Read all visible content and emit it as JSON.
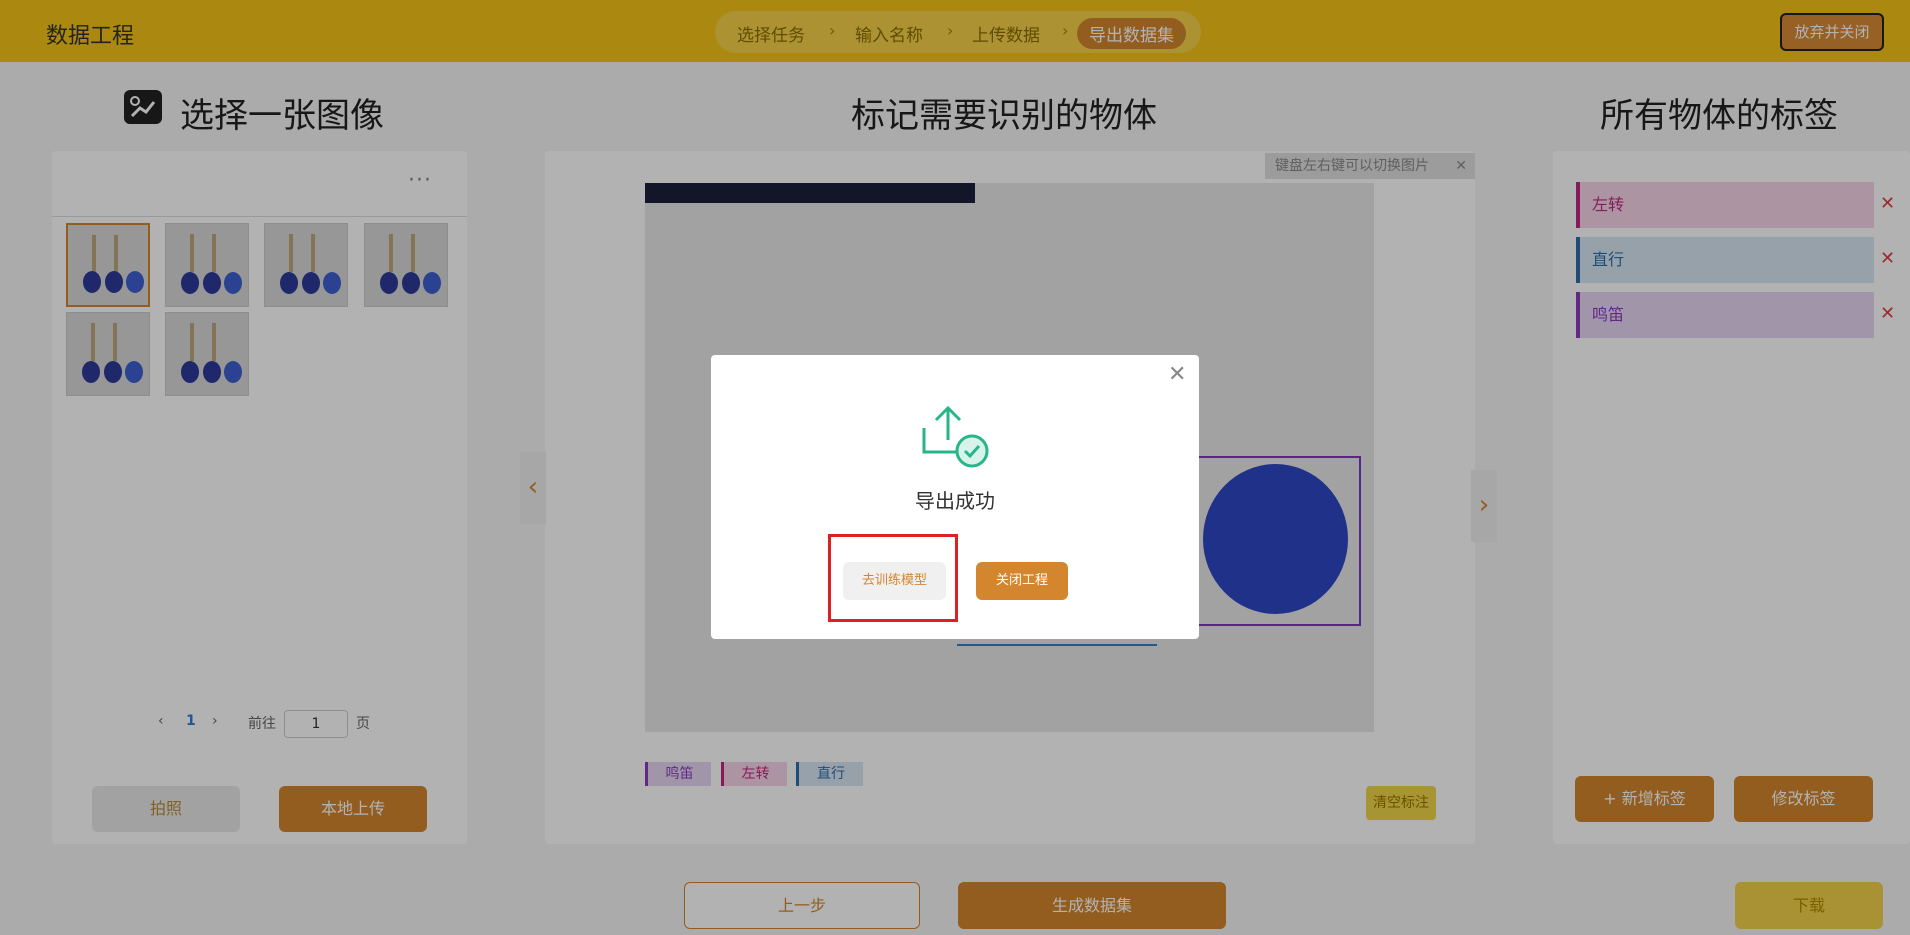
{
  "header": {
    "app_title": "数据工程",
    "steps": [
      "选择任务",
      "输入名称",
      "上传数据",
      "导出数据集"
    ],
    "active_step": 3,
    "close_button": "放弃并关闭"
  },
  "left": {
    "title": "选择一张图像",
    "more": "···",
    "pagination": {
      "prev": "‹",
      "page": "1",
      "next": "›",
      "goto": "前往",
      "input": "1",
      "page_suffix": "页"
    },
    "photo_button": "拍照",
    "upload_button": "本地上传"
  },
  "middle": {
    "title": "标记需要识别的物体",
    "hint": "键盘左右键可以切换图片",
    "hint_close": "✕",
    "prev_arrow": "‹",
    "next_arrow": "›",
    "tags": [
      "鸣笛",
      "左转",
      "直行"
    ],
    "clear_button": "清空标注"
  },
  "right": {
    "title": "所有物体的标签",
    "labels": [
      {
        "name": "左转",
        "color": "#c2267f",
        "bg": "#f7d5e8"
      },
      {
        "name": "直行",
        "color": "#2f6fad",
        "bg": "#d7e7f3"
      },
      {
        "name": "鸣笛",
        "color": "#8b3bbf",
        "bg": "#e7d7f3"
      }
    ],
    "delete_icon": "✕",
    "add_button": "+ 新增标签",
    "edit_button": "修改标签"
  },
  "bottom": {
    "prev_button": "上一步",
    "generate_button": "生成数据集",
    "download_button": "下载"
  },
  "modal": {
    "close": "✕",
    "title": "导出成功",
    "train_button": "去训练模型",
    "close_project_button": "关闭工程"
  },
  "colors": {
    "brand": "#f5c518",
    "accent": "#d4862f",
    "highlight": "#e02020"
  }
}
